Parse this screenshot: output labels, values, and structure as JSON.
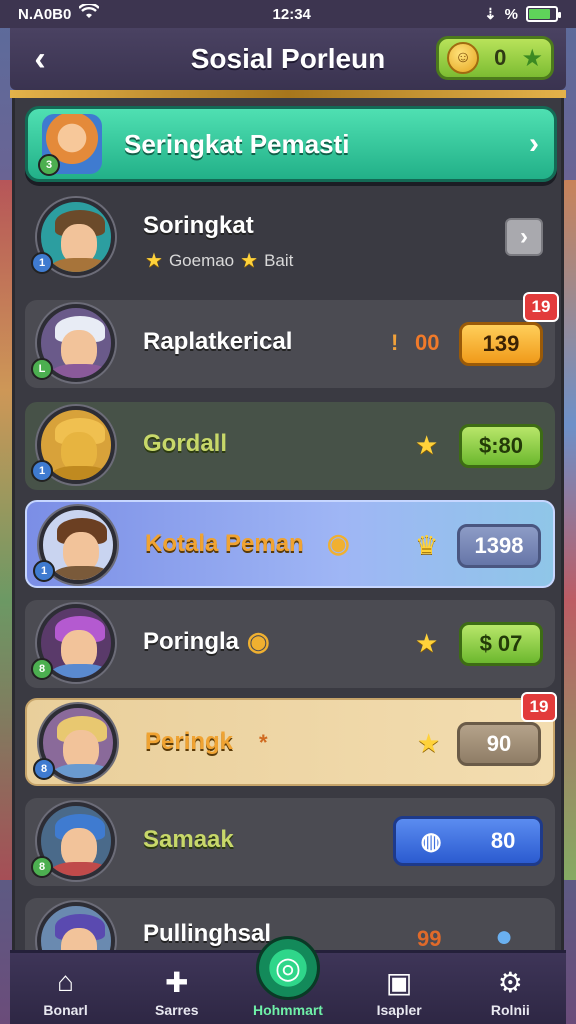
{
  "status_bar": {
    "carrier": "N.A0B0",
    "time": "12:34",
    "battery_icon": "battery-icon",
    "signal_text": "% "
  },
  "header": {
    "title": "Sosial Porleun",
    "back_icon": "back-arrow-icon",
    "coins": "0"
  },
  "banner": {
    "title": "Seringkat Pemasti",
    "chevron_icon": "chevron-right-icon"
  },
  "rows": [
    {
      "name": "Soringkat",
      "sub_a": "Goemao",
      "sub_b": "Bait",
      "action": "›"
    },
    {
      "name": "Raplatkerical",
      "mini": "00",
      "score": "139",
      "corner": "19"
    },
    {
      "name": "Gordall",
      "score": "$:80"
    },
    {
      "name": "Kotala Peman",
      "score": "1398"
    },
    {
      "name": "Poringla",
      "score": "$ 07"
    },
    {
      "name": "Peringk",
      "mini": "*",
      "score": "90",
      "corner": "19"
    },
    {
      "name": "Samaak",
      "score": "80"
    },
    {
      "name": "Pullinghsal",
      "mini": "99"
    }
  ],
  "nav": [
    {
      "label": "Bonarl",
      "icon": "home-icon"
    },
    {
      "label": "Sarres",
      "icon": "puzzle-icon"
    },
    {
      "label": "Hohmmart",
      "icon": "target-icon"
    },
    {
      "label": "Isapler",
      "icon": "calendar-icon"
    },
    {
      "label": "Rolnii",
      "icon": "settings-icon"
    }
  ],
  "colors": {
    "banner": "#22b088",
    "accent_gold": "#f2c94c",
    "panel": "#3a3a42"
  }
}
